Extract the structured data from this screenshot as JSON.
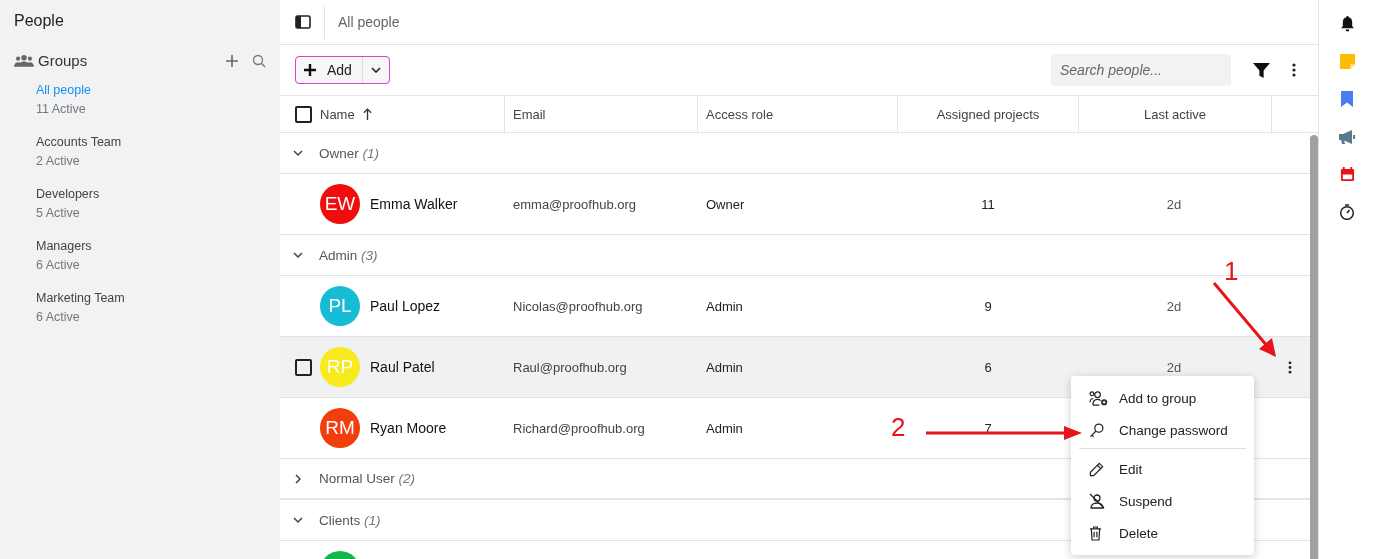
{
  "sidebar": {
    "title": "People",
    "groups_label": "Groups",
    "items": [
      {
        "label": "All people",
        "count": "11 Active",
        "selected": true
      },
      {
        "label": "Accounts Team",
        "count": "2 Active",
        "selected": false
      },
      {
        "label": "Developers",
        "count": "5 Active",
        "selected": false
      },
      {
        "label": "Managers",
        "count": "6 Active",
        "selected": false
      },
      {
        "label": "Marketing Team",
        "count": "6 Active",
        "selected": false
      }
    ]
  },
  "breadcrumb": "All people",
  "toolbar": {
    "add_label": "Add",
    "search": {
      "placeholder": "Search people..."
    }
  },
  "table": {
    "select_all_checked": false,
    "columns": [
      "Name",
      "Email",
      "Access role",
      "Assigned projects",
      "Last active"
    ],
    "groups": [
      {
        "label": "Owner",
        "count": "(1)",
        "expanded": true,
        "members": [
          {
            "initials": "EW",
            "name": "Emma Walker",
            "email": "emma@proofhub.org",
            "role": "Owner",
            "projects": "11",
            "last_active": "2d",
            "color": "#f20d0d",
            "hovered": false
          }
        ]
      },
      {
        "label": "Admin",
        "count": "(3)",
        "expanded": true,
        "members": [
          {
            "initials": "PL",
            "name": "Paul Lopez",
            "email": "Nicolas@proofhub.org",
            "role": "Admin",
            "projects": "9",
            "last_active": "2d",
            "color": "#16bcd4",
            "hovered": false
          },
          {
            "initials": "RP",
            "name": "Raul Patel",
            "email": "Raul@proofhub.org",
            "role": "Admin",
            "projects": "6",
            "last_active": "2d",
            "color": "#f7ea1d",
            "hovered": true,
            "checked": false
          },
          {
            "initials": "RM",
            "name": "Ryan Moore",
            "email": "Richard@proofhub.org",
            "role": "Admin",
            "projects": "7",
            "color": "#f23d0d",
            "hovered": false
          }
        ]
      },
      {
        "label": "Normal User",
        "count": "(2)",
        "expanded": false
      },
      {
        "label": "Clients",
        "count": "(1)",
        "expanded": true,
        "members": [
          {
            "color": "#12b84e",
            "hovered": false
          }
        ]
      }
    ]
  },
  "context_menu": {
    "sections": [
      [
        "Add to group",
        "Change password"
      ],
      [
        "Edit",
        "Suspend",
        "Delete"
      ]
    ]
  },
  "annotations": [
    {
      "label": "1"
    },
    {
      "label": "2"
    }
  ]
}
